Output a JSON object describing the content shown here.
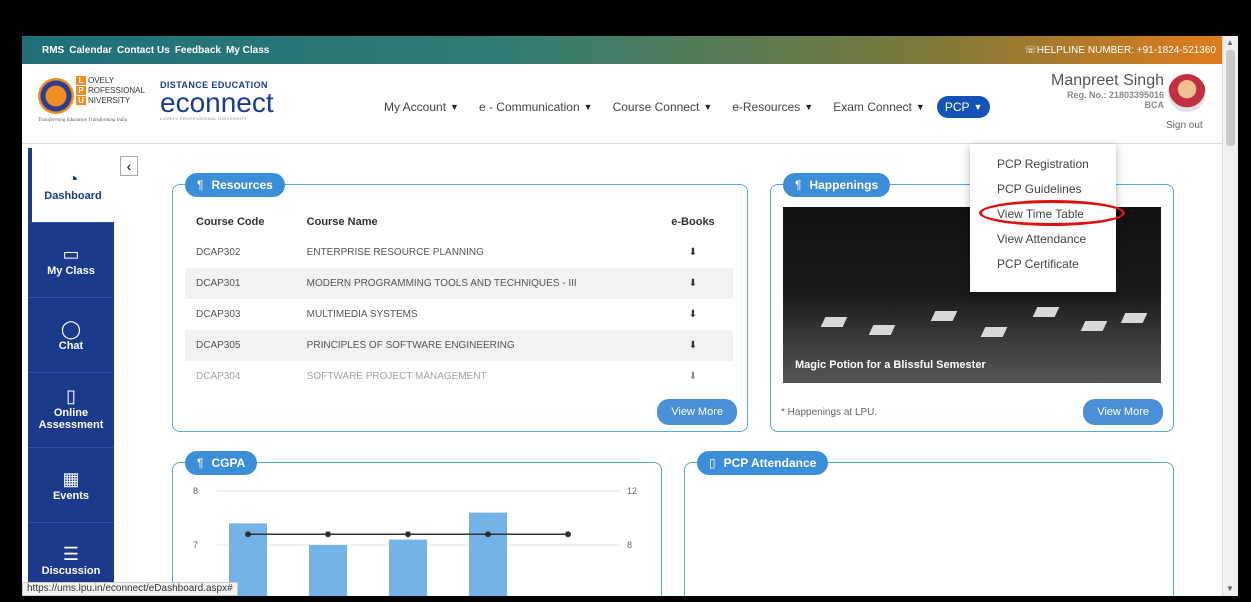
{
  "topbar": {
    "links": [
      "RMS",
      "Calendar",
      "Contact Us",
      "Feedback",
      "My Class"
    ],
    "helpline": "☏HELPLINE NUMBER: +91-1824-521360"
  },
  "logo": {
    "lines": [
      "OVELY",
      "ROFESSIONAL",
      "NIVERSITY"
    ],
    "initials": [
      "L",
      "P",
      "U"
    ],
    "tagline": "Transforming Education Transforming India",
    "distance": "DISTANCE EDUCATION",
    "econnect": "econnect",
    "econnect_sub": "LOVELY PROFESSIONAL UNIVERSITY"
  },
  "nav": {
    "items": [
      "My Account",
      "e - Communication",
      "Course Connect",
      "e-Resources",
      "Exam Connect"
    ],
    "pcp": "PCP"
  },
  "user": {
    "name": "Manpreet Singh",
    "reg": "Reg. No.: 21803395016",
    "course": "BCA",
    "signout": "Sign out"
  },
  "sidebar": {
    "items": [
      {
        "label": "Dashboard",
        "icon": "◔"
      },
      {
        "label": "My Class",
        "icon": "▭"
      },
      {
        "label": "Chat",
        "icon": "◯"
      },
      {
        "label": "Online Assessment",
        "icon": "▯"
      },
      {
        "label": "Events",
        "icon": "▦"
      },
      {
        "label": "Discussion",
        "icon": "☰"
      }
    ]
  },
  "resources": {
    "title": "Resources",
    "headers": [
      "Course Code",
      "Course Name",
      "e-Books"
    ],
    "rows": [
      {
        "code": "DCAP302",
        "name": "ENTERPRISE RESOURCE PLANNING"
      },
      {
        "code": "DCAP301",
        "name": "MODERN PROGRAMMING TOOLS AND TECHNIQUES - III"
      },
      {
        "code": "DCAP303",
        "name": "MULTIMEDIA SYSTEMS"
      },
      {
        "code": "DCAP305",
        "name": "PRINCIPLES OF SOFTWARE ENGINEERING"
      },
      {
        "code": "DCAP304",
        "name": "SOFTWARE PROJECT MANAGEMENT"
      }
    ],
    "view_more": "View More"
  },
  "happenings": {
    "title": "Happenings",
    "caption": "Magic Potion for a Blissful Semester",
    "note": "* Happenings at LPU.",
    "view_more": "View More"
  },
  "cgpa": {
    "title": "CGPA",
    "left_ticks": [
      "8",
      "7"
    ],
    "right_ticks": [
      "12",
      "8"
    ],
    "bar_values": [
      7.4,
      7.0,
      7.1,
      7.6
    ],
    "line_values": [
      7.2,
      7.2,
      7.2,
      7.2,
      7.2
    ]
  },
  "pcp_attendance": {
    "title": "PCP Attendance"
  },
  "pcp_menu": {
    "items": [
      "PCP Registration",
      "PCP Guidelines",
      "View Time Table",
      "View Attendance",
      "PCP Certificate"
    ]
  },
  "status_url": "https://ums.lpu.in/econnect/eDashboard.aspx#"
}
